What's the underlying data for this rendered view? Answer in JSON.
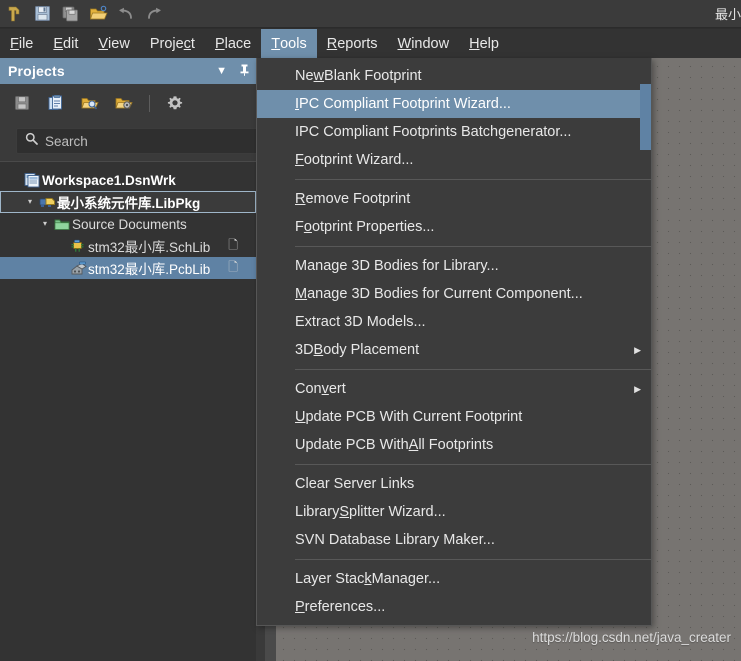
{
  "toolbar": {
    "icons": [
      "altium-logo",
      "save-icon",
      "save-all-icon",
      "open-folder-icon",
      "undo-icon",
      "redo-icon"
    ],
    "right_title": "最小"
  },
  "menubar": {
    "items": [
      {
        "pre": "",
        "mnemonic": "F",
        "post": "ile",
        "active": false
      },
      {
        "pre": "",
        "mnemonic": "E",
        "post": "dit",
        "active": false
      },
      {
        "pre": "",
        "mnemonic": "V",
        "post": "iew",
        "active": false
      },
      {
        "pre": "Proje",
        "mnemonic": "c",
        "post": "t",
        "active": false
      },
      {
        "pre": "",
        "mnemonic": "P",
        "post": "lace",
        "active": false
      },
      {
        "pre": "",
        "mnemonic": "T",
        "post": "ools",
        "active": true
      },
      {
        "pre": "",
        "mnemonic": "R",
        "post": "eports",
        "active": false
      },
      {
        "pre": "",
        "mnemonic": "W",
        "post": "indow",
        "active": false
      },
      {
        "pre": "",
        "mnemonic": "H",
        "post": "elp",
        "active": false
      }
    ]
  },
  "panel": {
    "title": "Projects",
    "header_icons": [
      "chevron-down-icon",
      "pin-icon"
    ],
    "toolbar_icons": [
      "save-icon",
      "documents-icon",
      "open-project-icon",
      "open-folder-options-icon",
      "gear-icon"
    ],
    "search": {
      "placeholder": "Search",
      "value": "",
      "icon": "search-icon"
    }
  },
  "tree": {
    "rows": [
      {
        "label": "Workspace1.DsnWrk",
        "icon": "workspace-icon",
        "indent": 1,
        "twisty": "",
        "bold": true,
        "state": "none",
        "doc": ""
      },
      {
        "label": "最小系统元件库.LibPkg",
        "icon": "libpkg-icon",
        "indent": 2,
        "twisty": "▾",
        "bold": true,
        "state": "focus",
        "doc": ""
      },
      {
        "label": "Source Documents",
        "icon": "folder-icon",
        "indent": 3,
        "twisty": "▾",
        "bold": false,
        "state": "none",
        "doc": ""
      },
      {
        "label": "stm32最小库.SchLib",
        "icon": "schlib-icon",
        "indent": 4,
        "twisty": "",
        "bold": false,
        "state": "none",
        "doc": "🗋"
      },
      {
        "label": "stm32最小库.PcbLib",
        "icon": "pcblib-icon",
        "indent": 4,
        "twisty": "",
        "bold": false,
        "state": "selected",
        "doc": "🗋"
      }
    ]
  },
  "menu": {
    "items": [
      {
        "type": "item",
        "pre": "Ne",
        "mnemonic": "w",
        "post": " Blank Footprint",
        "arrow": false,
        "highlight": false
      },
      {
        "type": "item",
        "pre": "",
        "mnemonic": "I",
        "post": "PC Compliant Footprint Wizard...",
        "arrow": false,
        "highlight": true
      },
      {
        "type": "item",
        "pre": "IPC Compliant Footprints Batch ",
        "mnemonic": "g",
        "post": "enerator...",
        "arrow": false,
        "highlight": false
      },
      {
        "type": "item",
        "pre": "",
        "mnemonic": "F",
        "post": "ootprint Wizard...",
        "arrow": false,
        "highlight": false
      },
      {
        "type": "sep"
      },
      {
        "type": "item",
        "pre": "",
        "mnemonic": "R",
        "post": "emove Footprint",
        "arrow": false,
        "highlight": false
      },
      {
        "type": "item",
        "pre": "F",
        "mnemonic": "o",
        "post": "otprint Properties...",
        "arrow": false,
        "highlight": false
      },
      {
        "type": "sep"
      },
      {
        "type": "item",
        "pre": "Manage 3D Bodies for Library...",
        "mnemonic": "",
        "post": "",
        "arrow": false,
        "highlight": false
      },
      {
        "type": "item",
        "pre": "",
        "mnemonic": "M",
        "post": "anage 3D Bodies for Current Component...",
        "arrow": false,
        "highlight": false
      },
      {
        "type": "item",
        "pre": "Extract 3D Models...",
        "mnemonic": "",
        "post": "",
        "arrow": false,
        "highlight": false
      },
      {
        "type": "item",
        "pre": "3D ",
        "mnemonic": "B",
        "post": "ody Placement",
        "arrow": true,
        "highlight": false
      },
      {
        "type": "sep"
      },
      {
        "type": "item",
        "pre": "Con",
        "mnemonic": "v",
        "post": "ert",
        "arrow": true,
        "highlight": false
      },
      {
        "type": "item",
        "pre": "",
        "mnemonic": "U",
        "post": "pdate PCB With Current Footprint",
        "arrow": false,
        "highlight": false
      },
      {
        "type": "item",
        "pre": "Update PCB With ",
        "mnemonic": "A",
        "post": "ll Footprints",
        "arrow": false,
        "highlight": false
      },
      {
        "type": "sep"
      },
      {
        "type": "item",
        "pre": "Clear Server Links",
        "mnemonic": "",
        "post": "",
        "arrow": false,
        "highlight": false
      },
      {
        "type": "item",
        "pre": "Library ",
        "mnemonic": "S",
        "post": "plitter Wizard...",
        "arrow": false,
        "highlight": false
      },
      {
        "type": "item",
        "pre": "SVN Database Library Maker...",
        "mnemonic": "",
        "post": "",
        "arrow": false,
        "highlight": false
      },
      {
        "type": "sep"
      },
      {
        "type": "item",
        "pre": "Layer Stac",
        "mnemonic": "k",
        "post": " Manager...",
        "arrow": false,
        "highlight": false
      },
      {
        "type": "item",
        "pre": "",
        "mnemonic": "P",
        "post": "references...",
        "arrow": false,
        "highlight": false
      }
    ]
  },
  "canvas": {
    "watermark": "https://blog.csdn.net/java_creater"
  },
  "colors": {
    "accent": "#6f8fab",
    "panel_bg": "#333333",
    "menu_bg": "#3c3c3c",
    "canvas_bg": "#777471",
    "toolbar_bg": "#3b3b3b"
  }
}
